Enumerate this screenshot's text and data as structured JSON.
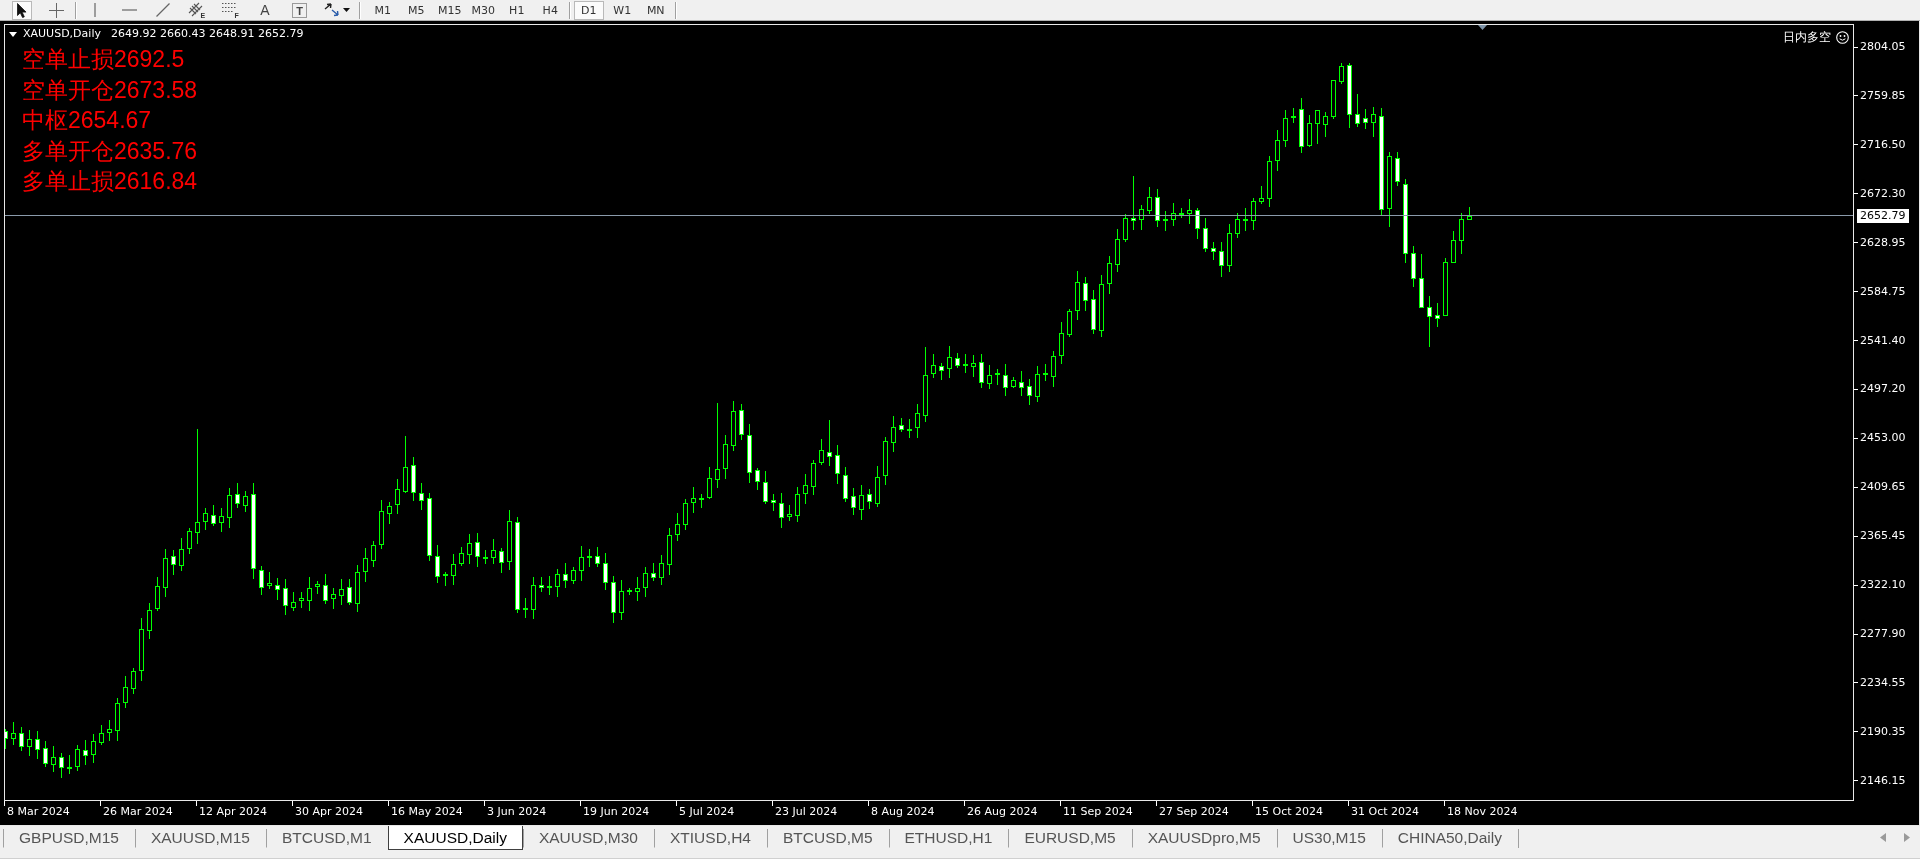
{
  "toolbar": {
    "tool_groups": [
      {
        "tools": [
          {
            "kind": "cursor",
            "selected": true
          },
          {
            "kind": "crosshair",
            "selected": false
          }
        ]
      },
      {
        "tools": [
          {
            "kind": "vertical_line",
            "selected": false
          },
          {
            "kind": "horizontal_line",
            "selected": false
          },
          {
            "kind": "trendline",
            "selected": false
          },
          {
            "kind": "channel",
            "selected": false,
            "letter": "E"
          },
          {
            "kind": "levels",
            "selected": false,
            "letter": "F"
          },
          {
            "kind": "text",
            "selected": false,
            "letter": "A"
          },
          {
            "kind": "label",
            "selected": false,
            "letter": "T"
          },
          {
            "kind": "arrows",
            "selected": false
          }
        ]
      }
    ],
    "timeframe_groups": [
      {
        "items": [
          {
            "label": "M1",
            "selected": false
          },
          {
            "label": "M5",
            "selected": false
          },
          {
            "label": "M15",
            "selected": false
          },
          {
            "label": "M30",
            "selected": false
          },
          {
            "label": "H1",
            "selected": false
          },
          {
            "label": "H4",
            "selected": false
          }
        ]
      },
      {
        "items": [
          {
            "label": "D1",
            "selected": true
          },
          {
            "label": "W1",
            "selected": false
          },
          {
            "label": "MN",
            "selected": false
          }
        ]
      }
    ]
  },
  "chart": {
    "header": {
      "symbol": "XAUUSD,Daily",
      "quote": "2649.92 2660.43 2648.91 2652.79"
    },
    "levels": [
      "空单止损2692.5",
      "空单开仓2673.58",
      "中枢2654.67",
      "多单开仓2635.76",
      "多单止损2616.84"
    ],
    "indicator_label": "日内多空",
    "price_axis": {
      "labels": [
        "2804.05",
        "2759.85",
        "2716.50",
        "2672.30",
        "2628.95",
        "2584.75",
        "2541.40",
        "2497.20",
        "2453.00",
        "2409.65",
        "2365.45",
        "2322.10",
        "2277.90",
        "2234.55",
        "2190.35",
        "2146.15"
      ],
      "current_price": "2652.79"
    },
    "time_axis": {
      "labels": [
        "8 Mar 2024",
        "26 Mar 2024",
        "12 Apr 2024",
        "30 Apr 2024",
        "16 May 2024",
        "3 Jun 2024",
        "19 Jun 2024",
        "5 Jul 2024",
        "23 Jul 2024",
        "8 Aug 2024",
        "26 Aug 2024",
        "11 Sep 2024",
        "27 Sep 2024",
        "15 Oct 2024",
        "31 Oct 2024",
        "18 Nov 2024"
      ]
    }
  },
  "symbol_tabs": [
    {
      "label": "GBPUSD,M15",
      "selected": false
    },
    {
      "label": "XAUUSD,M15",
      "selected": false
    },
    {
      "label": "BTCUSD,M1",
      "selected": false
    },
    {
      "label": "XAUUSD,Daily",
      "selected": true
    },
    {
      "label": "XAUUSD,M30",
      "selected": false
    },
    {
      "label": "XTIUSD,H4",
      "selected": false
    },
    {
      "label": "BTCUSD,M5",
      "selected": false
    },
    {
      "label": "ETHUSD,H1",
      "selected": false
    },
    {
      "label": "EURUSD,M5",
      "selected": false
    },
    {
      "label": "XAUUSDpro,M5",
      "selected": false
    },
    {
      "label": "US30,M15",
      "selected": false
    },
    {
      "label": "CHINA50,Daily",
      "selected": false
    }
  ]
}
